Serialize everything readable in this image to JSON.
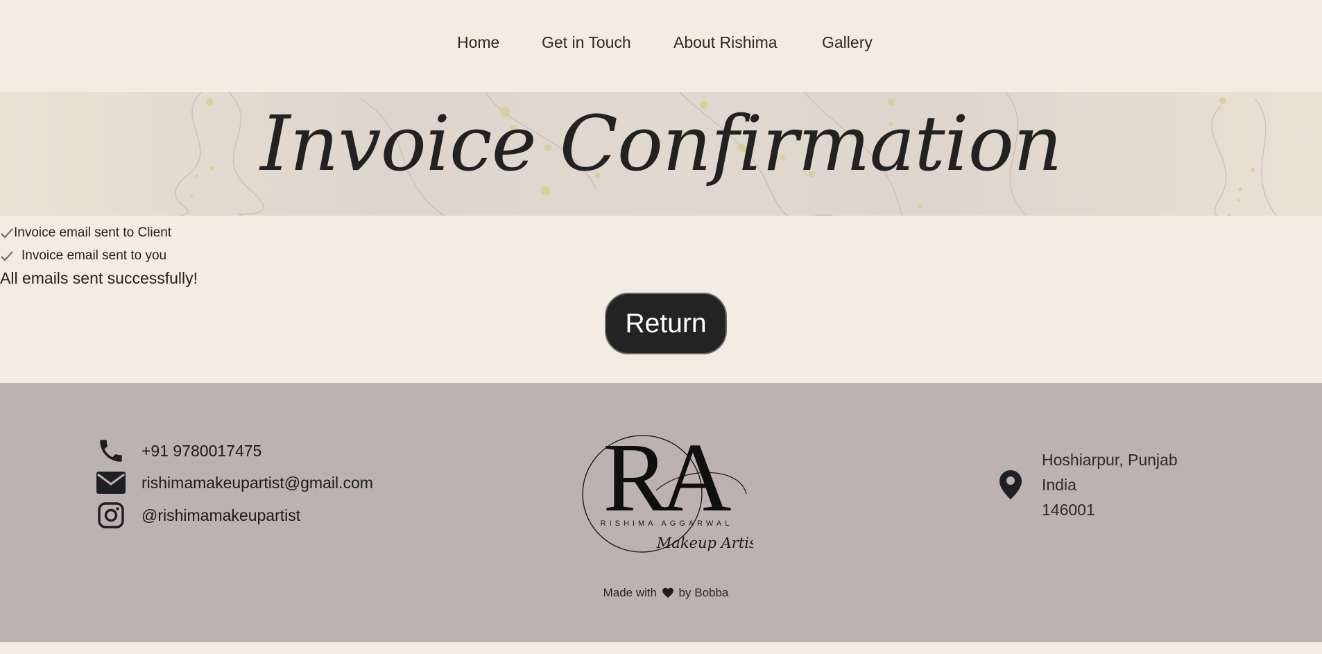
{
  "nav": {
    "items": [
      {
        "label": "Home"
      },
      {
        "label": "Get in Touch"
      },
      {
        "label": "About Rishima"
      },
      {
        "label": "Gallery"
      }
    ]
  },
  "banner": {
    "title": "Invoice Confirmation"
  },
  "status": {
    "client_sent": "Invoice email sent to Client",
    "you_sent": "Invoice email sent to you",
    "summary": "All emails sent successfully!"
  },
  "actions": {
    "return_label": "Return"
  },
  "footer": {
    "phone": "+91 9780017475",
    "email": "rishimamakeupartist@gmail.com",
    "instagram": "@rishimamakeupartist",
    "logo": {
      "monogram": "RA",
      "name": "RISHIMA AGGARWAL",
      "tagline": "Makeup Artist"
    },
    "address": {
      "line1": "Hoshiarpur, Punjab",
      "line2": "India",
      "line3": "146001"
    },
    "credit": {
      "prefix": "Made with",
      "suffix": "by Bobba"
    }
  },
  "colors": {
    "page_bg": "#f2ece2",
    "footer_bg": "#bcb2b1",
    "button_bg": "#232323",
    "text": "#222222"
  },
  "icons": {
    "check": "check-icon",
    "phone": "phone-icon",
    "email": "envelope-icon",
    "instagram": "instagram-icon",
    "location": "map-pin-icon",
    "heart": "heart-icon"
  }
}
